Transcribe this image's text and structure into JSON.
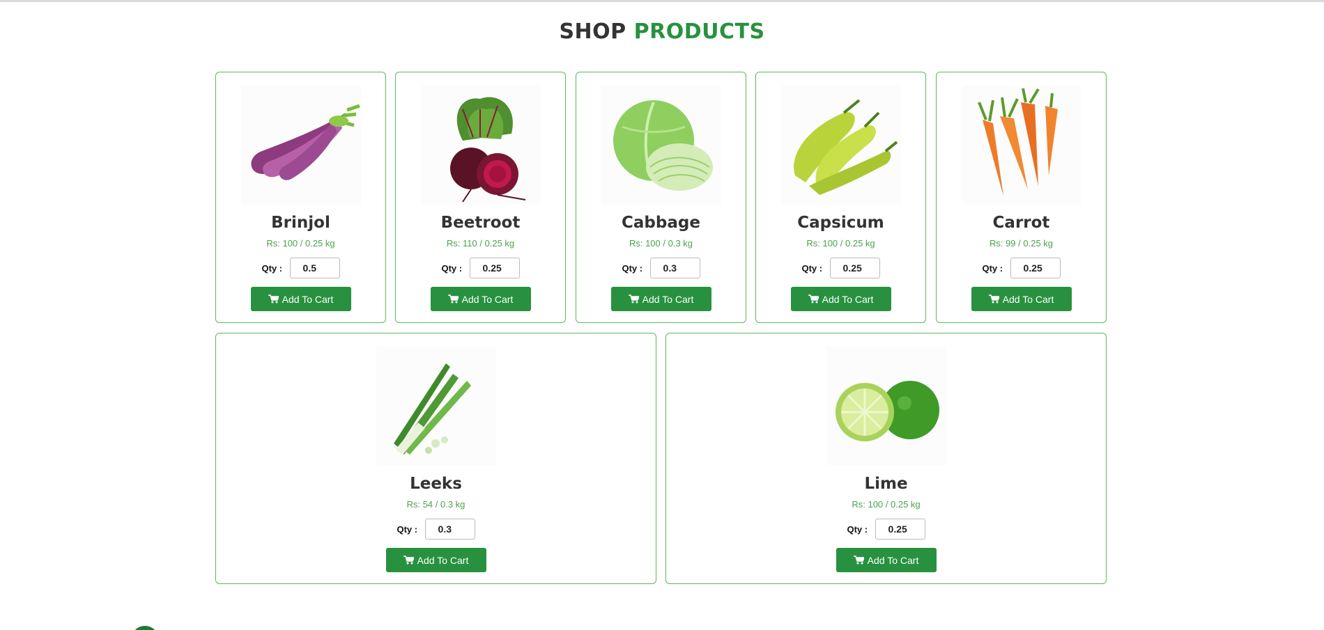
{
  "heading": {
    "part1": "SHOP",
    "part2": "PRODUCTS"
  },
  "colors": {
    "accent": "#28913f",
    "border": "#5cb85c",
    "price": "#4aa24a"
  },
  "qty_label": "Qty :",
  "button_label": "Add To Cart",
  "products": [
    {
      "name": "Brinjol",
      "price": "Rs: 100 / 0.25 kg",
      "qty": "0.5",
      "image": "brinjal-image"
    },
    {
      "name": "Beetroot",
      "price": "Rs: 110 / 0.25 kg",
      "qty": "0.25",
      "image": "beetroot-image"
    },
    {
      "name": "Cabbage",
      "price": "Rs: 100 / 0.3 kg",
      "qty": "0.3",
      "image": "cabbage-image"
    },
    {
      "name": "Capsicum",
      "price": "Rs: 100 / 0.25 kg",
      "qty": "0.25",
      "image": "capsicum-image"
    },
    {
      "name": "Carrot",
      "price": "Rs: 99 / 0.25 kg",
      "qty": "0.25",
      "image": "carrot-image"
    },
    {
      "name": "Leeks",
      "price": "Rs: 54 / 0.3 kg",
      "qty": "0.3",
      "image": "leeks-image"
    },
    {
      "name": "Lime",
      "price": "Rs: 100 / 0.25 kg",
      "qty": "0.25",
      "image": "lime-image"
    }
  ]
}
